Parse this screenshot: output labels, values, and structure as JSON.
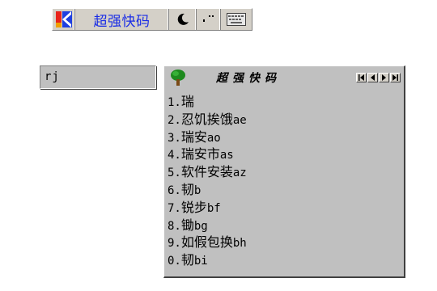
{
  "status_bar": {
    "ime_name": "超强快码",
    "icons": [
      "ime-logo-icon",
      "half-width-moon-icon",
      "punctuation-mode-icon",
      "soft-keyboard-icon"
    ]
  },
  "composition": {
    "value": "rj"
  },
  "candidate_window": {
    "title": "超强快码",
    "pager_icons": [
      "first-page-icon",
      "prev-page-icon",
      "next-page-icon",
      "last-page-icon"
    ],
    "candidates": [
      {
        "num": "1.",
        "text": "瑞",
        "code": ""
      },
      {
        "num": "2.",
        "text": "忍饥挨饿",
        "code": "ae"
      },
      {
        "num": "3.",
        "text": "瑞安",
        "code": "ao"
      },
      {
        "num": "4.",
        "text": "瑞安市",
        "code": "as"
      },
      {
        "num": "5.",
        "text": "软件安装",
        "code": "az"
      },
      {
        "num": "6.",
        "text": "韧",
        "code": "b"
      },
      {
        "num": "7.",
        "text": "锐步",
        "code": "bf"
      },
      {
        "num": "8.",
        "text": "锄",
        "code": "bg"
      },
      {
        "num": "9.",
        "text": "如假包换",
        "code": "bh"
      },
      {
        "num": "0.",
        "text": "韧",
        "code": "bi"
      }
    ]
  },
  "colors": {
    "face": "#c0c0c0",
    "statusbar_face": "#d4d0c8",
    "ime_name_blue": "#1a2de6",
    "logo_red": "#e8231a",
    "logo_blue": "#1f3fe0"
  }
}
